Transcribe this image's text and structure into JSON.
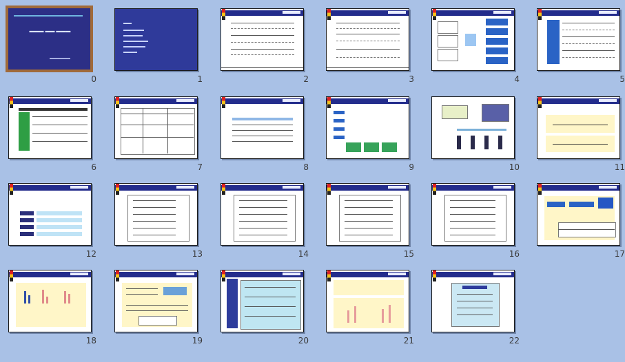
{
  "slides": [
    {
      "label": "0",
      "selected": true,
      "kind": "title"
    },
    {
      "label": "1",
      "selected": false,
      "kind": "toc"
    },
    {
      "label": "2",
      "selected": false,
      "kind": "text"
    },
    {
      "label": "3",
      "selected": false,
      "kind": "text"
    },
    {
      "label": "4",
      "selected": false,
      "kind": "diagram"
    },
    {
      "label": "5",
      "selected": false,
      "kind": "table"
    },
    {
      "label": "6",
      "selected": false,
      "kind": "table"
    },
    {
      "label": "7",
      "selected": false,
      "kind": "table"
    },
    {
      "label": "8",
      "selected": false,
      "kind": "table"
    },
    {
      "label": "9",
      "selected": false,
      "kind": "diagram"
    },
    {
      "label": "10",
      "selected": false,
      "kind": "diagram"
    },
    {
      "label": "11",
      "selected": false,
      "kind": "diagram"
    },
    {
      "label": "12",
      "selected": false,
      "kind": "table"
    },
    {
      "label": "13",
      "selected": false,
      "kind": "text"
    },
    {
      "label": "14",
      "selected": false,
      "kind": "text"
    },
    {
      "label": "15",
      "selected": false,
      "kind": "text"
    },
    {
      "label": "16",
      "selected": false,
      "kind": "text"
    },
    {
      "label": "17",
      "selected": false,
      "kind": "diagram"
    },
    {
      "label": "18",
      "selected": false,
      "kind": "chart"
    },
    {
      "label": "19",
      "selected": false,
      "kind": "diagram"
    },
    {
      "label": "20",
      "selected": false,
      "kind": "text"
    },
    {
      "label": "21",
      "selected": false,
      "kind": "chart"
    },
    {
      "label": "22",
      "selected": false,
      "kind": "text"
    }
  ],
  "colors": {
    "background": "#a9c1e6",
    "selection": "#a06a3a",
    "header": "#232c8c"
  }
}
